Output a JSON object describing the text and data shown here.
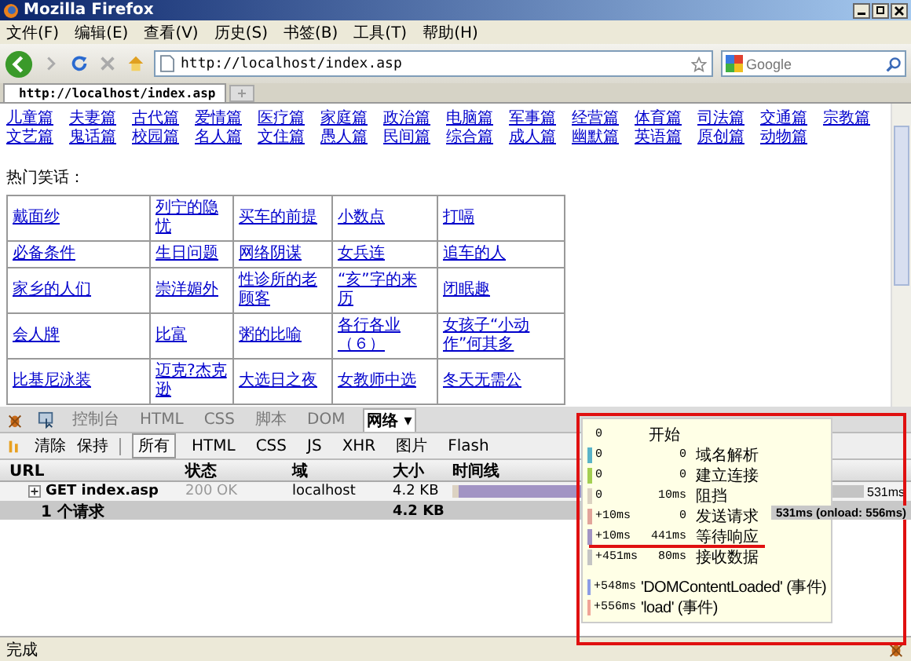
{
  "window": {
    "title": "Mozilla Firefox"
  },
  "menu": [
    "文件(F)",
    "编辑(E)",
    "查看(V)",
    "历史(S)",
    "书签(B)",
    "工具(T)",
    "帮助(H)"
  ],
  "address": {
    "value": "http://localhost/index.asp"
  },
  "search": {
    "placeholder": "Google"
  },
  "tabs": [
    {
      "label": "http://localhost/index.asp",
      "selected": true
    }
  ],
  "page": {
    "category_links": [
      "儿童篇",
      "夫妻篇",
      "古代篇",
      "爱情篇",
      "医疗篇",
      "家庭篇",
      "政治篇",
      "电脑篇",
      "军事篇",
      "经营篇",
      "体育篇",
      "司法篇",
      "交通篇",
      "宗教篇",
      "文艺篇",
      "鬼话篇",
      "校园篇",
      "名人篇",
      "文住篇",
      "愚人篇",
      "民间篇",
      "综合篇",
      "成人篇",
      "幽默篇",
      "英语篇",
      "原创篇",
      "动物篇"
    ],
    "heading": "热门笑话：",
    "jokes": [
      [
        "戴面纱",
        "列宁的隐忧",
        "买车的前提",
        "小数点",
        "打嗝"
      ],
      [
        "必备条件",
        "生日问题",
        "网络阴谋",
        "女兵连",
        "追车的人"
      ],
      [
        "家乡的人们",
        "崇洋媚外",
        "性诊所的老顾客",
        "“亥”字的来历",
        "闭眠趣"
      ],
      [
        "会人牌",
        "比富",
        "粥的比喻",
        "各行各业（６）",
        "女孩子“小动作”何其多"
      ],
      [
        "比基尼泳装",
        "迈克?杰克逊",
        "大选日之夜",
        "女教师中选",
        "冬天无需公"
      ]
    ]
  },
  "firebug": {
    "tabs": [
      {
        "label": "控制台",
        "selected": false
      },
      {
        "label": "HTML",
        "selected": false
      },
      {
        "label": "CSS",
        "selected": false
      },
      {
        "label": "脚本",
        "selected": false
      },
      {
        "label": "DOM",
        "selected": false
      },
      {
        "label": "网络 ▾",
        "selected": true
      }
    ],
    "actions": [
      "清除",
      "保持"
    ],
    "filters": [
      {
        "label": "所有",
        "selected": true
      },
      {
        "label": "HTML",
        "selected": false
      },
      {
        "label": "CSS",
        "selected": false
      },
      {
        "label": "JS",
        "selected": false
      },
      {
        "label": "XHR",
        "selected": false
      },
      {
        "label": "图片",
        "selected": false
      },
      {
        "label": "Flash",
        "selected": false
      }
    ],
    "columns": [
      "URL",
      "状态",
      "域",
      "大小",
      "时间线"
    ],
    "request": {
      "url": "GET index.asp",
      "status": "200 OK",
      "domain": "localhost",
      "size": "4.2 KB",
      "time": "531ms"
    },
    "summary": {
      "count": "1 个请求",
      "size": "4.2 KB",
      "time": "531ms (onload: 556ms)"
    },
    "timing": {
      "start": {
        "time": "0",
        "label": "开始"
      },
      "phases": [
        {
          "start": "0",
          "duration": "0",
          "label": "域名解析",
          "color": "#5ab4c8"
        },
        {
          "start": "0",
          "duration": "0",
          "label": "建立连接",
          "color": "#a4cf52"
        },
        {
          "start": "0",
          "duration": "10ms",
          "label": "阻挡",
          "color": "#dcd2c2"
        },
        {
          "start": "+10ms",
          "duration": "0",
          "label": "发送请求",
          "color": "#e2a49a"
        },
        {
          "start": "+10ms",
          "duration": "441ms",
          "label": "等待响应",
          "color": "#a294c4"
        },
        {
          "start": "+451ms",
          "duration": "80ms",
          "label": "接收数据",
          "color": "#c4c4c4"
        }
      ],
      "events": [
        {
          "time": "+548ms",
          "label": "'DOMContentLoaded' (事件)",
          "color": "#8c9ce6"
        },
        {
          "time": "+556ms",
          "label": "'load' (事件)",
          "color": "#f0a496"
        }
      ]
    }
  },
  "status_bar": {
    "text": "完成"
  }
}
